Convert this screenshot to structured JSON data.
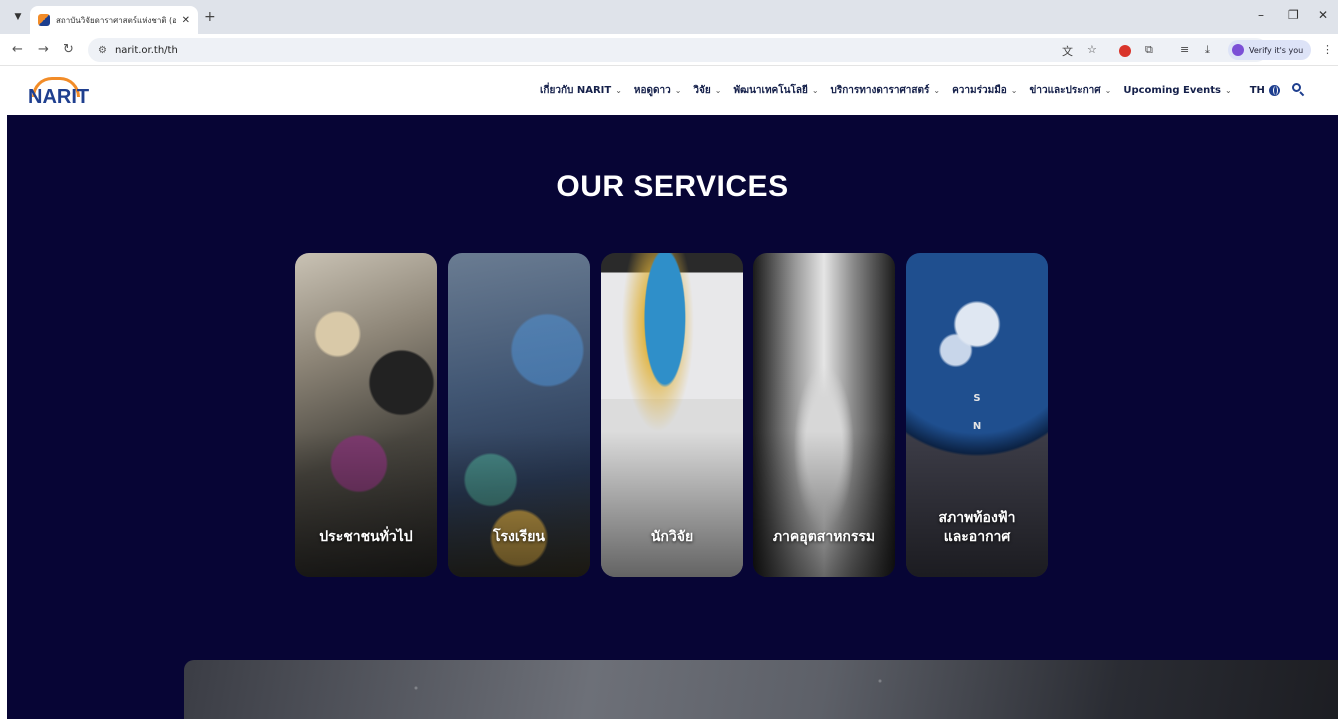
{
  "browser": {
    "tab_title": "สถาบันวิจัยดาราศาสตร์แห่งชาติ (องค์",
    "url": "narit.or.th/th",
    "verify_label": "Verify it's you"
  },
  "site": {
    "logo_text": "NARIT",
    "nav": [
      {
        "label": "เกี่ยวกับ NARIT"
      },
      {
        "label": "หอดูดาว"
      },
      {
        "label": "วิจัย"
      },
      {
        "label": "พัฒนาเทคโนโลยี"
      },
      {
        "label": "บริการทางดาราศาสตร์"
      },
      {
        "label": "ความร่วมมือ"
      },
      {
        "label": "ข่าวและประกาศ"
      },
      {
        "label": "Upcoming Events"
      }
    ],
    "language": "TH"
  },
  "services": {
    "title": "OUR SERVICES",
    "cards": [
      {
        "label": "ประชาชนทั่วไป"
      },
      {
        "label": "โรงเรียน"
      },
      {
        "label": "นักวิจัย"
      },
      {
        "label": "ภาคอุตสาหกรรม"
      },
      {
        "label": "สภาพท้องฟ้า และอากาศ",
        "compass_top": "S",
        "compass_bottom": "N"
      }
    ]
  },
  "icons": {
    "chevron": "chevron-down-icon",
    "globe": "globe-icon",
    "search": "search-icon"
  },
  "colors": {
    "page_background": "#070535",
    "nav_text": "#15204a",
    "logo_blue": "#1f3f8f",
    "logo_orange": "#f28c28"
  }
}
